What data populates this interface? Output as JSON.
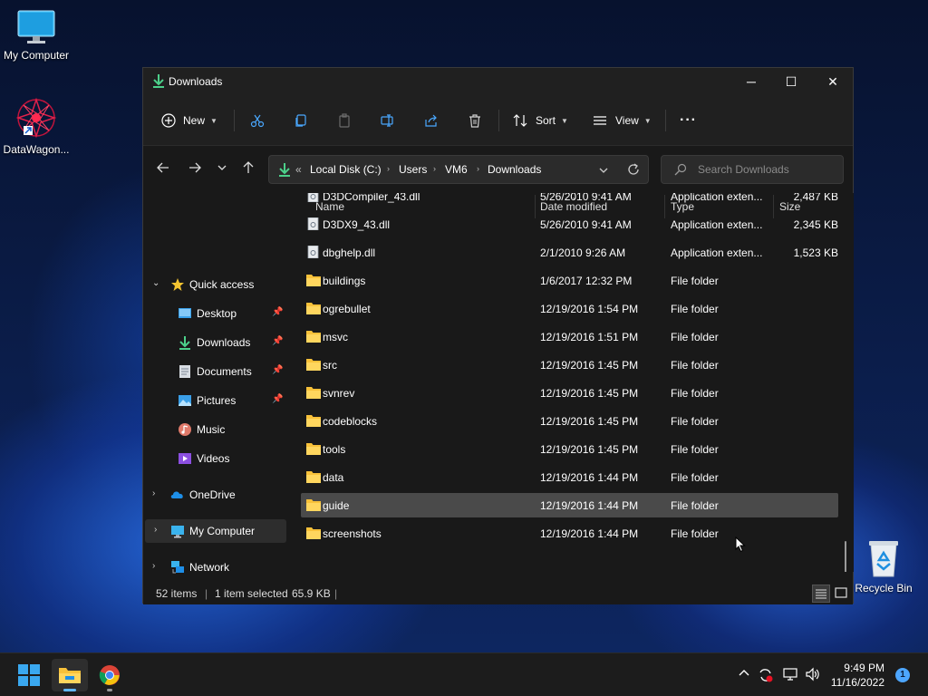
{
  "desktop": {
    "icons": [
      {
        "label": "My Computer"
      },
      {
        "label": "DataWagon..."
      },
      {
        "label": "Recycle Bin"
      }
    ]
  },
  "window": {
    "title": "Downloads",
    "controls": {
      "minimize": "─",
      "maximize": "☐",
      "close": "✕"
    }
  },
  "toolbar": {
    "new_label": "New",
    "sort_label": "Sort",
    "view_label": "View",
    "more_label": "···"
  },
  "address": {
    "overflow": "«",
    "crumbs": [
      "Local Disk (C:)",
      "Users",
      "VM6",
      "Downloads"
    ],
    "separator": "›",
    "search_placeholder": "Search Downloads"
  },
  "navpane": {
    "quick_access": "Quick access",
    "items": [
      {
        "label": "Desktop",
        "pinned": true
      },
      {
        "label": "Downloads",
        "pinned": true
      },
      {
        "label": "Documents",
        "pinned": true
      },
      {
        "label": "Pictures",
        "pinned": true
      },
      {
        "label": "Music",
        "pinned": false
      },
      {
        "label": "Videos",
        "pinned": false
      }
    ],
    "onedrive": "OneDrive",
    "my_computer": "My Computer",
    "network": "Network"
  },
  "columns": {
    "name": "Name",
    "date": "Date modified",
    "type": "Type",
    "size": "Size"
  },
  "files": [
    {
      "name": "D3DCompiler_43.dll",
      "date": "5/26/2010 9:41 AM",
      "type": "Application exten...",
      "size": "2,487 KB",
      "kind": "dll"
    },
    {
      "name": "D3DX9_43.dll",
      "date": "5/26/2010 9:41 AM",
      "type": "Application exten...",
      "size": "2,345 KB",
      "kind": "dll"
    },
    {
      "name": "dbghelp.dll",
      "date": "2/1/2010 9:26 AM",
      "type": "Application exten...",
      "size": "1,523 KB",
      "kind": "dll"
    },
    {
      "name": "buildings",
      "date": "1/6/2017 12:32 PM",
      "type": "File folder",
      "size": "",
      "kind": "folder"
    },
    {
      "name": "ogrebullet",
      "date": "12/19/2016 1:54 PM",
      "type": "File folder",
      "size": "",
      "kind": "folder"
    },
    {
      "name": "msvc",
      "date": "12/19/2016 1:51 PM",
      "type": "File folder",
      "size": "",
      "kind": "folder"
    },
    {
      "name": "src",
      "date": "12/19/2016 1:45 PM",
      "type": "File folder",
      "size": "",
      "kind": "folder"
    },
    {
      "name": "svnrev",
      "date": "12/19/2016 1:45 PM",
      "type": "File folder",
      "size": "",
      "kind": "folder"
    },
    {
      "name": "codeblocks",
      "date": "12/19/2016 1:45 PM",
      "type": "File folder",
      "size": "",
      "kind": "folder"
    },
    {
      "name": "tools",
      "date": "12/19/2016 1:45 PM",
      "type": "File folder",
      "size": "",
      "kind": "folder"
    },
    {
      "name": "data",
      "date": "12/19/2016 1:44 PM",
      "type": "File folder",
      "size": "",
      "kind": "folder"
    },
    {
      "name": "guide",
      "date": "12/19/2016 1:44 PM",
      "type": "File folder",
      "size": "",
      "kind": "folder",
      "selected": true
    },
    {
      "name": "screenshots",
      "date": "12/19/2016 1:44 PM",
      "type": "File folder",
      "size": "",
      "kind": "folder"
    }
  ],
  "status": {
    "items": "52 items",
    "selection": "1 item selected",
    "size": "65.9 KB",
    "divider": "|"
  },
  "taskbar": {
    "time": "9:49 PM",
    "date": "11/16/2022",
    "notification_count": "1"
  },
  "colors": {
    "accent": "#0078d4",
    "folder": "#f8c13a",
    "selected_row": "#4a4a4a"
  }
}
